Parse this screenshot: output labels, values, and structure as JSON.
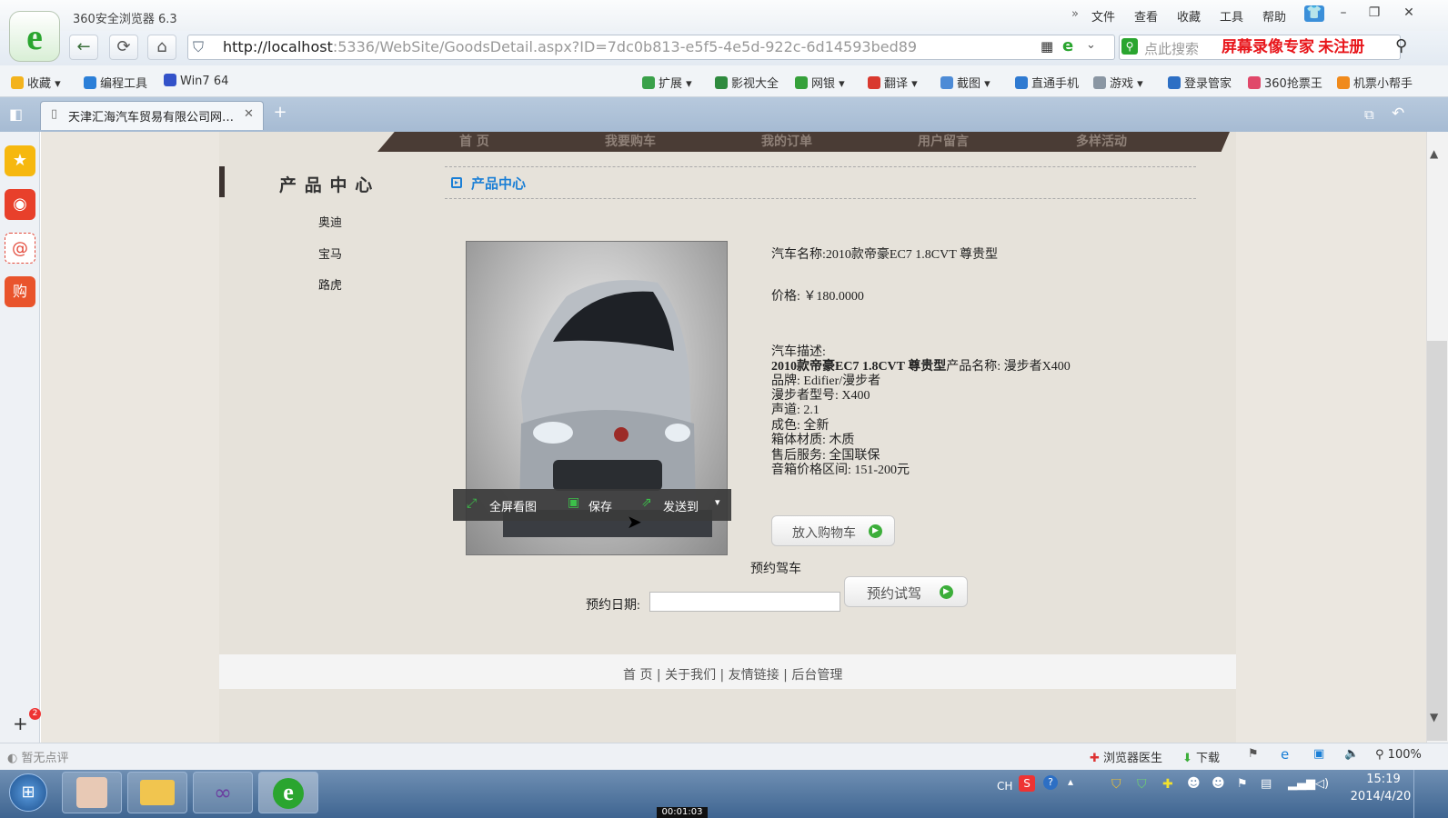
{
  "browser": {
    "title": "360安全浏览器 6.3",
    "menu": [
      "文件",
      "查看",
      "收藏",
      "工具",
      "帮助"
    ],
    "url_host": "http://localhost",
    "url_rest": ":5336/WebSite/GoodsDetail.aspx?ID=7dc0b813-e5f5-4e5d-922c-6d14593bed89",
    "search_placeholder": "点此搜索",
    "recorder_label": "屏幕录像专家  未注册"
  },
  "bookmarks_left": [
    "收藏",
    "编程工具",
    "Win7 64"
  ],
  "bookmarks_right": [
    "扩展",
    "影视大全",
    "网银",
    "翻译",
    "截图",
    "直通手机",
    "游戏",
    "登录管家",
    "360抢票王",
    "机票小帮手"
  ],
  "tab": {
    "title": "天津汇海汽车贸易有限公司网…"
  },
  "site": {
    "nav": [
      "首 页",
      "我要购车",
      "我的订单",
      "用户留言",
      "多样活动"
    ],
    "category_title": "产 品 中 心",
    "categories": [
      "奥迪",
      "宝马",
      "路虎"
    ],
    "breadcrumb": "产品中心",
    "product": {
      "name_label": "汽车名称:",
      "name": "2010款帝豪EC7 1.8CVT 尊贵型",
      "price_label": "价格:",
      "price": "￥180.0000",
      "desc_label": "汽车描述:",
      "desc_bold": "2010款帝豪EC7 1.8CVT 尊贵型",
      "desc_rest": "产品名称: 漫步者X400",
      "desc_lines": [
        "品牌: Edifier/漫步者",
        "漫步者型号: X400",
        "声道: 2.1",
        "成色: 全新",
        "箱体材质: 木质",
        "售后服务: 全国联保",
        "音箱价格区间: 151-200元"
      ]
    },
    "image_toolbar": [
      "全屏看图",
      "保存",
      "发送到"
    ],
    "cart_button": "放入购物车",
    "booking_title": "预约驾车",
    "booking_date_label": "预约日期:",
    "booking_button": "预约试驾",
    "footer_links": [
      "首 页",
      "关于我们",
      "友情链接",
      "后台管理"
    ]
  },
  "status": {
    "comment": "暂无点评",
    "doctor": "浏览器医生",
    "download": "下载",
    "zoom": "100%"
  },
  "taskbar": {
    "ime": "CH",
    "time": "15:19",
    "date": "2014/4/20",
    "timer": "00:01:03"
  },
  "colors": {
    "accent_blue": "#1a7fd6",
    "recorder_red": "#e8161b",
    "nav_dark": "#4a3c35"
  }
}
